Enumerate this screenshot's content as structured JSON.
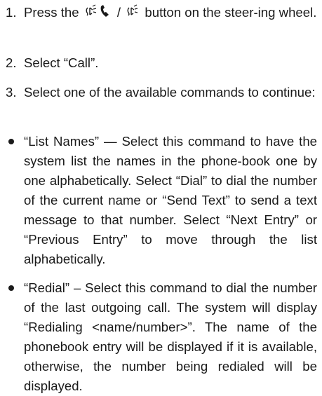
{
  "steps": [
    {
      "number": "1.",
      "before_icons": "Press the",
      "separator": "/",
      "after_icons": "button on the steer-ing wheel."
    },
    {
      "number": "2.",
      "text": "Select “Call”."
    },
    {
      "number": "3.",
      "text": "Select one of the available commands to continue:"
    }
  ],
  "bullets": [
    {
      "text": "“List Names” — Select this command to have the system list the names in the phone-book one by one alphabetically. Select “Dial” to dial the number of the current name or “Send Text” to send a text message to that number. Select “Next Entry” or “Previous Entry” to move through the list alphabetically."
    },
    {
      "text": "“Redial” – Select this command to dial the number of the last outgoing call. The system will display “Redialing <name/number>”. The name of the phonebook entry will be displayed if it is available, otherwise, the number being redialed will be displayed."
    }
  ],
  "icons": [
    "talk-phone-icon",
    "talk-icon"
  ]
}
